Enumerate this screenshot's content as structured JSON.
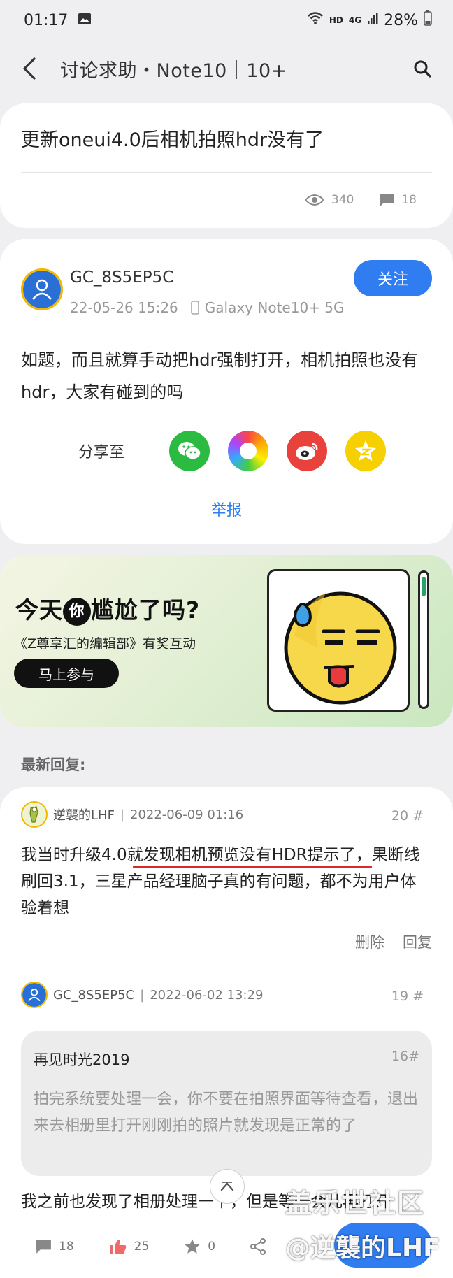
{
  "status": {
    "time": "01:17",
    "hd": "HD",
    "network": "4G",
    "battery": "28%"
  },
  "header": {
    "title": "讨论求助・Note10｜10+"
  },
  "post": {
    "title": "更新oneui4.0后相机拍照hdr没有了",
    "views": "340",
    "comments": "18",
    "author": "GC_8S5EP5C",
    "date": "22-05-26 15:26",
    "device": "Galaxy Note10+ 5G",
    "follow_label": "关注",
    "body": "如题，而且就算手动把hdr强制打开，相机拍照也没有hdr，大家有碰到的吗",
    "share_label": "分享至",
    "report_label": "举报"
  },
  "banner": {
    "headline_before": "今天",
    "headline_badge": "你",
    "headline_after": "尴尬了吗?",
    "subtitle": "《Z尊享汇的编辑部》有奖互动",
    "button": "马上参与"
  },
  "replies_label": "最新回复:",
  "replies": [
    {
      "author": "逆襲的LHF",
      "time": "2022-06-09 01:16",
      "floor": "20 #",
      "text": "我当时升级4.0就发现相机预览没有HDR提示了，果断线刷回3.1，三星产品经理脑子真的有问题，都不为用户体验着想",
      "delete_label": "删除",
      "reply_label": "回复"
    },
    {
      "author": "GC_8S5EP5C",
      "time": "2022-06-02 13:29",
      "floor": "19 #",
      "quote_author": "再见时光2019",
      "quote_floor": "16#",
      "quote_text": "拍完系统要处理一会，你不要在拍照界面等待查看，退出来去相册里打开刚刚拍的照片就发现是正常的了",
      "text": "我之前也发现了相册处理一下，但是等一会儿再打开"
    }
  ],
  "bottom_bar": {
    "comments": "18",
    "likes": "25",
    "favorites": "0"
  },
  "watermark": {
    "line1": "盖乐世社区",
    "line2": "@逆襲的LHF"
  },
  "colors": {
    "accent": "#2f7df0",
    "underline": "#d92a2a",
    "avatar_ring": "#f2b800"
  }
}
